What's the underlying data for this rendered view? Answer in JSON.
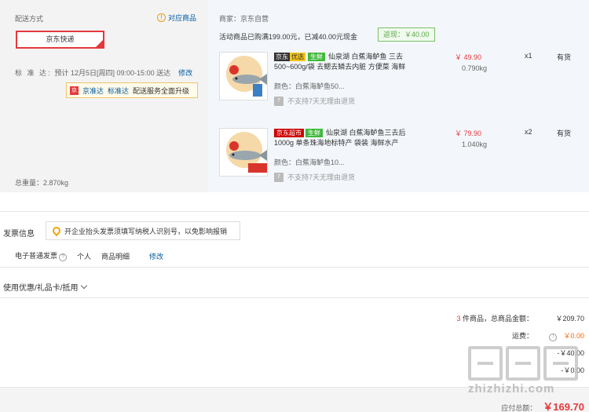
{
  "shipping": {
    "label": "配送方式",
    "match_link": "对应商品",
    "selected_method": "京东快递",
    "standard_label": "标 准 达:",
    "standard_text": "预计 12月5日[周四] 09:00-15:00 送达",
    "edit": "修改",
    "upgrade": {
      "brand": "京准达",
      "std": "标准达",
      "text": "配送服务全面升级"
    },
    "total_weight": "总重量：2.870kg"
  },
  "merchant": {
    "label": "商家：京东自营",
    "promo": "活动商品已购满199.00元，已减40.00元现金",
    "rebate": "返现：￥40.00"
  },
  "items": [
    {
      "tag_brand": "京东",
      "tag_sub": "优选",
      "tag_fresh": "生鲜",
      "title": "仙泉湖 白蕉海鲈鱼 三去500~600g/袋 去鳃去鳞去内脏 方便菜 海鲜",
      "color": "颜色：白蕉海鲈鱼50...",
      "no_return": "不支持7天无理由退货",
      "price": "￥ 49.90",
      "weight": "0.790kg",
      "qty": "x1",
      "stock": "有货"
    },
    {
      "tag_brand": "京东超市",
      "tag_sub": "",
      "tag_fresh": "生鲜",
      "title": "仙泉湖 白蕉海鲈鱼三去后1000g 单条珠海地标特产 袋装 海鲜水产",
      "color": "颜色：白蕉海鲈鱼10...",
      "no_return": "不支持7天无理由退货",
      "price": "￥ 79.90",
      "weight": "1.040kg",
      "qty": "x2",
      "stock": "有货"
    }
  ],
  "invoice": {
    "title": "发票信息",
    "tip": "开企业抬头发票须填写纳税人识别号，以免影响报销",
    "type": "电子普通发票",
    "person": "个人",
    "detail": "商品明细",
    "edit": "修改"
  },
  "coupon": {
    "label": "使用优惠/礼品卡/抵用"
  },
  "summary": {
    "count": "3",
    "count_suffix": " 件商品，总商品金额：",
    "total": "￥209.70",
    "shipping_label": "运费：",
    "shipping_value": "￥0.00",
    "row3_value": "-￥40.00",
    "row4_value": "-￥0.00",
    "payable_label": "应付总额：",
    "payable_value": "￥169.70"
  },
  "watermark": "zhizhizhi.com",
  "colors": {
    "accent_red": "#e4393c",
    "link_blue": "#005aa0",
    "fresh_green": "#41b93c"
  }
}
